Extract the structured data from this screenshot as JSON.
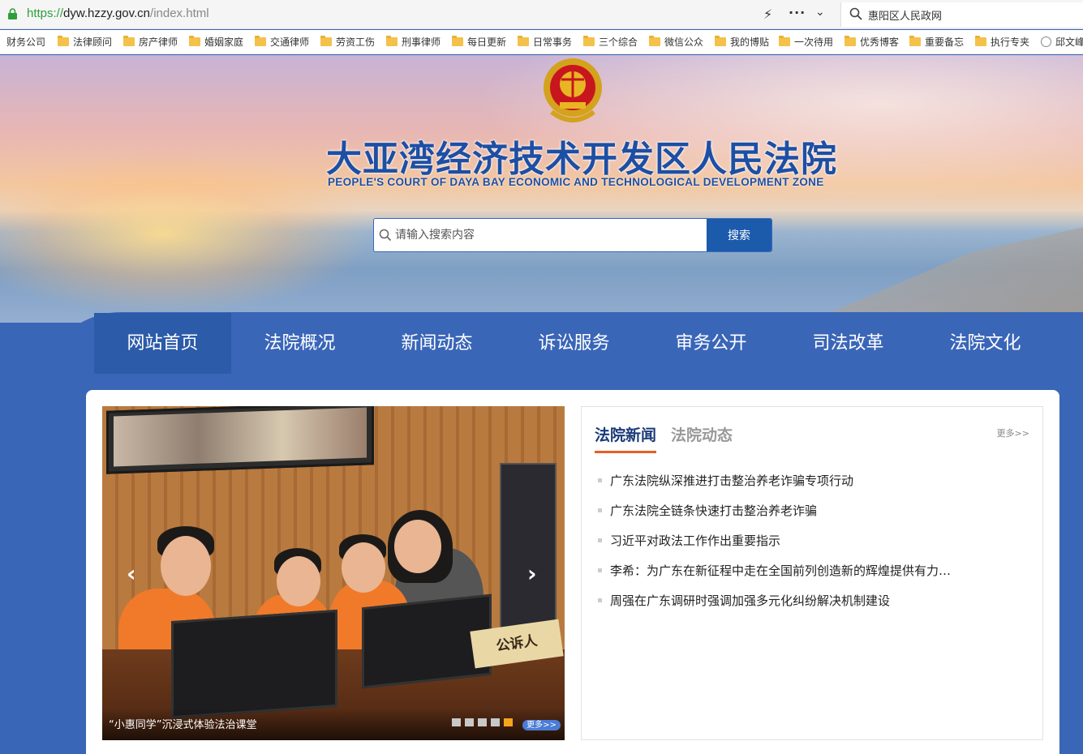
{
  "browser": {
    "url_proto": "https://",
    "url_host": "dyw.hzzy.gov.cn",
    "url_path": "/index.html",
    "search_text": "惠阳区人民政网",
    "bookmarks": [
      "财务公司",
      "法律顾问",
      "房产律师",
      "婚姻家庭",
      "交通律师",
      "劳资工伤",
      "刑事律师",
      "每日更新",
      "日常事务",
      "三个综合",
      "微信公众",
      "我的博贴",
      "一次待用",
      "优秀博客",
      "重要备忘",
      "执行专夹",
      "邱文峰"
    ]
  },
  "header": {
    "title_cn": "大亚湾经济技术开发区人民法院",
    "title_en": "PEOPLE'S COURT OF DAYA BAY ECONOMIC AND TECHNOLOGICAL DEVELOPMENT ZONE",
    "search_placeholder": "请输入搜索内容",
    "search_button": "搜索"
  },
  "nav": [
    "网站首页",
    "法院概况",
    "新闻动态",
    "诉讼服务",
    "审务公开",
    "司法改革",
    "法院文化"
  ],
  "slider": {
    "caption": "“小惠同学”沉浸式体验法治课堂",
    "plate_text": "公诉人",
    "more": "更多>>",
    "dot_count": 5,
    "active_dot": 4
  },
  "news": {
    "tab_active": "法院新闻",
    "tab_inactive": "法院动态",
    "more": "更多>>",
    "items": [
      "广东法院纵深推进打击整治养老诈骗专项行动",
      "广东法院全链条快速打击整治养老诈骗",
      "习近平对政法工作作出重要指示",
      "李希：为广东在新征程中走在全国前列创造新的辉煌提供有力…",
      "周强在广东调研时强调加强多元化纠纷解决机制建设"
    ]
  },
  "colors": {
    "nav_bg": "#3a66b8",
    "brand_blue": "#1d4fa4",
    "accent_orange": "#e85d24"
  }
}
